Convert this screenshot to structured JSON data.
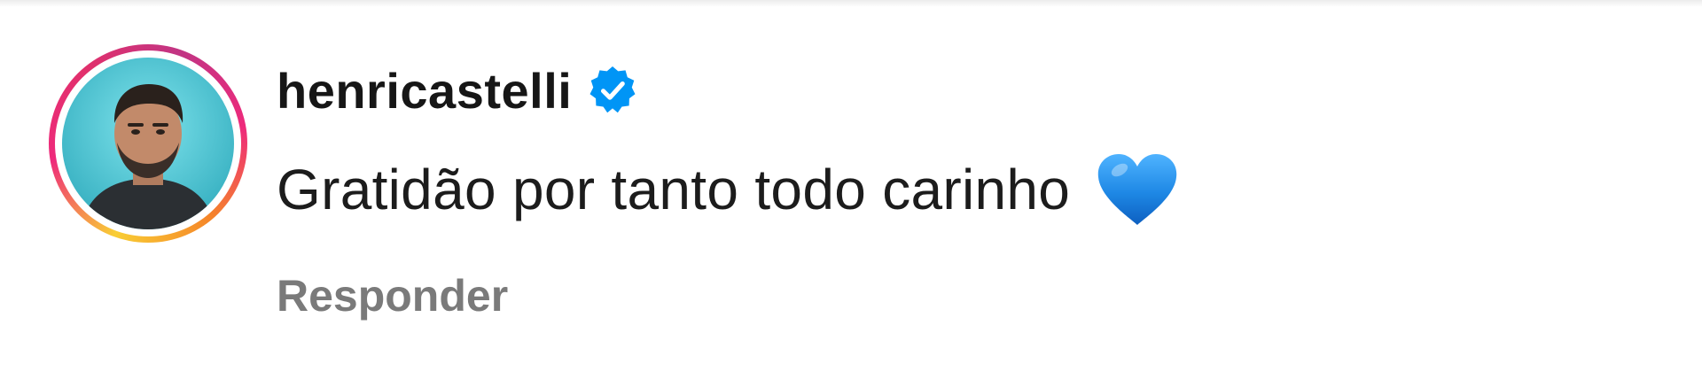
{
  "comment": {
    "username": "henricastelli",
    "verified": true,
    "text": "Gratidão por tanto todo carinho",
    "emoji": "blue-heart",
    "reply_label": "Responder"
  },
  "icons": {
    "verified": "verified-badge-icon",
    "heart": "blue-heart-icon",
    "avatar_ring": "story-ring"
  },
  "colors": {
    "verified_blue": "#0095f6",
    "heart_blue": "#1e88e5",
    "username": "#161616",
    "reply_gray": "#7a7a7a"
  }
}
